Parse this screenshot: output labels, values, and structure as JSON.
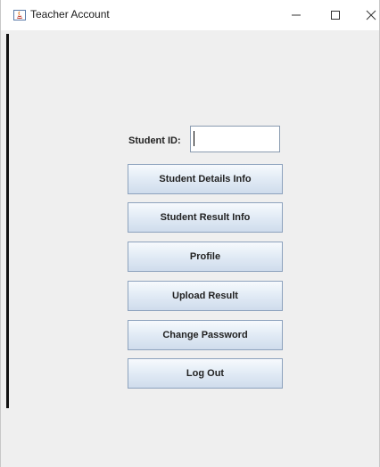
{
  "window": {
    "title": "Teacher Account",
    "controls": {
      "minimize": "—",
      "maximize": "☐",
      "close": "✕"
    }
  },
  "form": {
    "student_id_label": "Student ID:",
    "student_id_value": ""
  },
  "buttons": {
    "student_details": "Student Details Info",
    "student_result": "Student Result Info",
    "profile": "Profile",
    "upload_result": "Upload Result",
    "change_password": "Change Password",
    "log_out": "Log Out"
  },
  "colors": {
    "background": "#efefef",
    "button_border": "#8da2bd",
    "title_bar": "#ffffff"
  }
}
